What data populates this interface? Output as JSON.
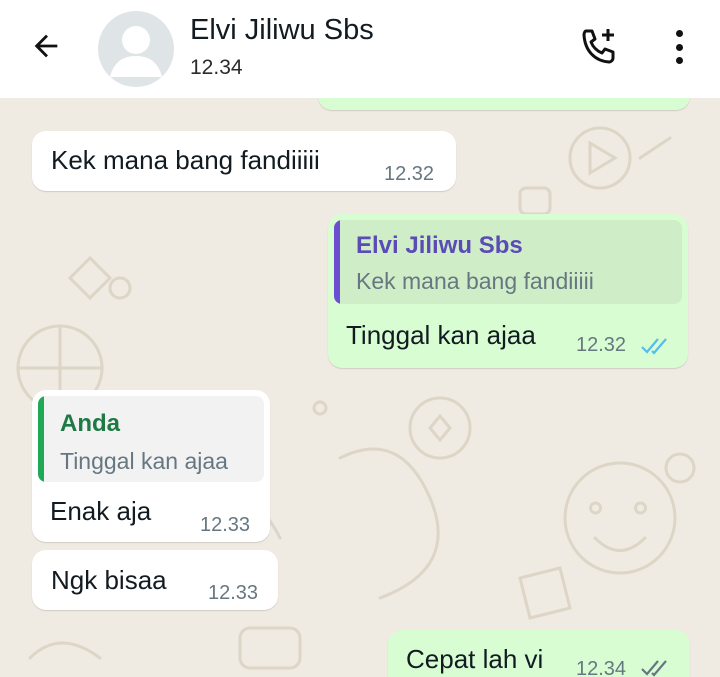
{
  "header": {
    "contact_name": "Elvi Jiliwu Sbs",
    "last_seen": "12.34",
    "back_icon": "arrow-left-icon",
    "call_icon": "add-call-icon",
    "menu_icon": "more-vertical-icon"
  },
  "colors": {
    "incoming_bubble": "#ffffff",
    "outgoing_bubble": "#d9fdd3",
    "wallpaper": "#efeae2",
    "read_ticks": "#53bdeb",
    "quote_bar_purple": "#6c4ed3",
    "quote_bar_green": "#1fa855"
  },
  "messages": [
    {
      "type": "outgoing",
      "partial": true
    },
    {
      "type": "incoming",
      "text": "Kek mana bang fandiiiii",
      "time": "12.32"
    },
    {
      "type": "outgoing",
      "quote": {
        "author": "Elvi Jiliwu Sbs",
        "text": "Kek mana bang fandiiiii"
      },
      "text": "Tinggal kan ajaa",
      "time": "12.32",
      "status": "read"
    },
    {
      "type": "incoming",
      "quote": {
        "author": "Anda",
        "text": "Tinggal kan ajaa"
      },
      "text": "Enak aja",
      "time": "12.33"
    },
    {
      "type": "incoming",
      "text": "Ngk bisaa",
      "time": "12.33"
    },
    {
      "type": "outgoing",
      "text": "Cepat lah vi",
      "time": "12.34",
      "status": "delivered"
    }
  ]
}
